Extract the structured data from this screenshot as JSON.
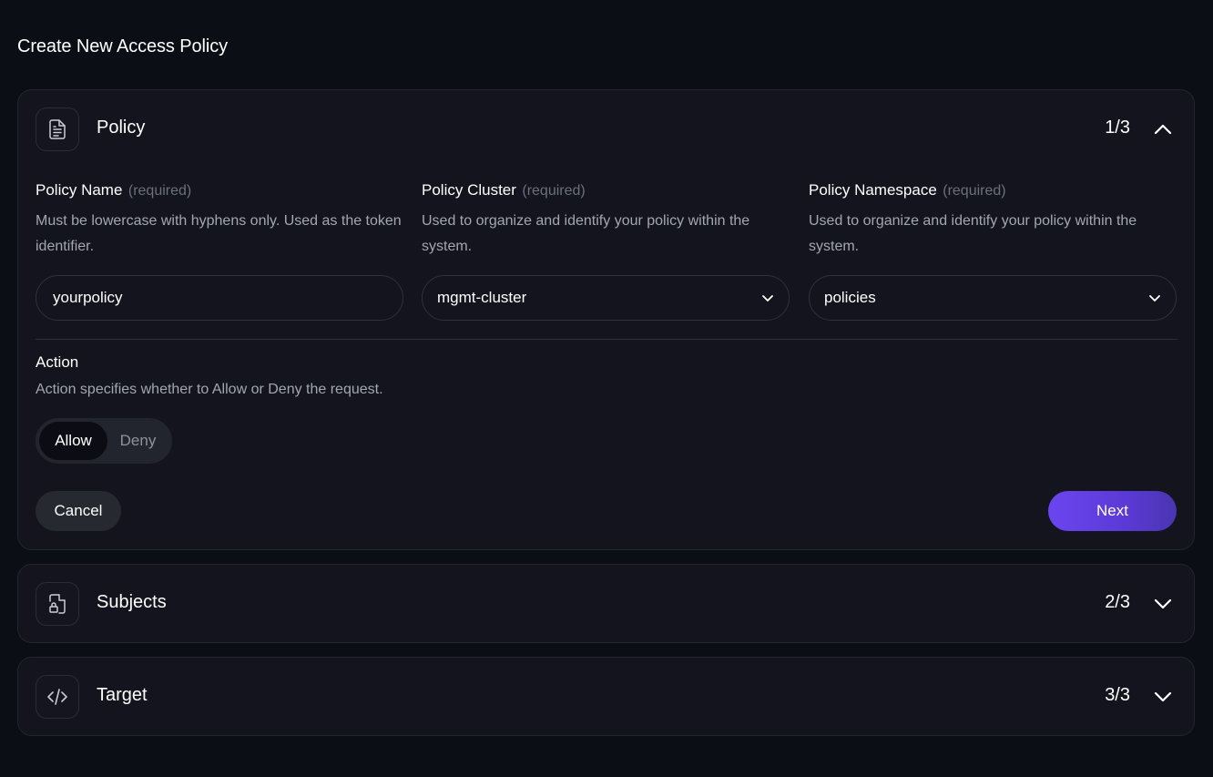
{
  "page": {
    "title": "Create New Access Policy"
  },
  "sections": [
    {
      "title": "Policy",
      "step": "1/3",
      "icon": "document-icon",
      "expanded": true
    },
    {
      "title": "Subjects",
      "step": "2/3",
      "icon": "file-lock-icon",
      "expanded": false
    },
    {
      "title": "Target",
      "step": "3/3",
      "icon": "code-icon",
      "expanded": false
    }
  ],
  "policy_form": {
    "name": {
      "label": "Policy Name",
      "required": "(required)",
      "help": "Must be lowercase with hyphens only. Used as the token identifier.",
      "value": "yourpolicy"
    },
    "cluster": {
      "label": "Policy Cluster",
      "required": "(required)",
      "help": "Used to organize and identify your policy within the system.",
      "value": "mgmt-cluster"
    },
    "namespace": {
      "label": "Policy Namespace",
      "required": "(required)",
      "help": "Used to organize and identify your policy within the system.",
      "value": "policies"
    },
    "action": {
      "label": "Action",
      "help": "Action specifies whether to Allow or Deny the request.",
      "options": [
        "Allow",
        "Deny"
      ],
      "selected": "Allow"
    }
  },
  "buttons": {
    "cancel": "Cancel",
    "next": "Next"
  },
  "colors": {
    "background": "#0c0e16",
    "card": "#13141d",
    "accent": "#6b45f0"
  }
}
